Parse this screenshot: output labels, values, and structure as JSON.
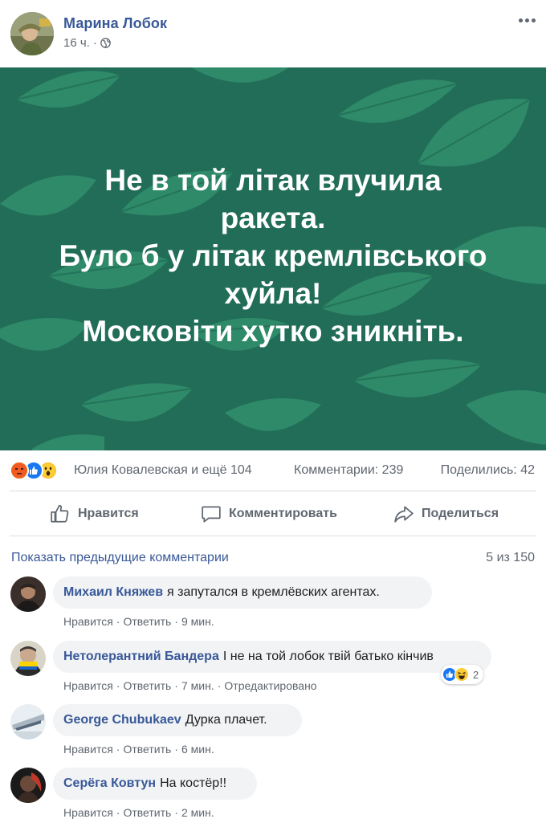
{
  "post": {
    "author": "Марина Лобок",
    "time": "16 ч.",
    "separator": "·",
    "icons": {
      "privacy": "globe-icon",
      "more": "more-options-icon"
    },
    "image_text": [
      "Не в той літак влучила",
      "ракета.",
      "Було б у літак кремлівського",
      "хуйла!",
      "Московіти хутко зникніть."
    ],
    "colors": {
      "background": "#226d57",
      "leaf_light": "#2e8a69",
      "leaf_dark": "#1d5f4b",
      "accent": "#385898"
    }
  },
  "reactions": {
    "icons": [
      "angry-icon",
      "like-icon",
      "wow-icon"
    ],
    "names": "Юлия Ковалевская и ещё 104",
    "comments": "Комментарии: 239",
    "shares": "Поделились: 42"
  },
  "actions": {
    "like": "Нравится",
    "comment": "Комментировать",
    "share": "Поделиться"
  },
  "comments_section": {
    "show_previous": "Показать предыдущие комментарии",
    "counter": "5 из 150",
    "items": [
      {
        "author": "Михаил Княжев",
        "text": "я запутался в кремлёвских агентах.",
        "like": "Нравится",
        "reply": "Ответить",
        "time": "9 мин."
      },
      {
        "author": "Нетолерантний Бандера",
        "text": "І не на той лобок твій батько кінчив",
        "like": "Нравится",
        "reply": "Ответить",
        "time": "7 мин.",
        "edited": "Отредактировано",
        "reaction_icons": [
          "like-icon",
          "haha-icon"
        ],
        "reaction_count": "2"
      },
      {
        "author": "George Chubukaev",
        "text": "Дурка плачет.",
        "like": "Нравится",
        "reply": "Ответить",
        "time": "6 мин."
      },
      {
        "author": "Серёга Ковтун",
        "text": "На костёр!!",
        "like": "Нравится",
        "reply": "Ответить",
        "time": "2 мин."
      }
    ]
  }
}
